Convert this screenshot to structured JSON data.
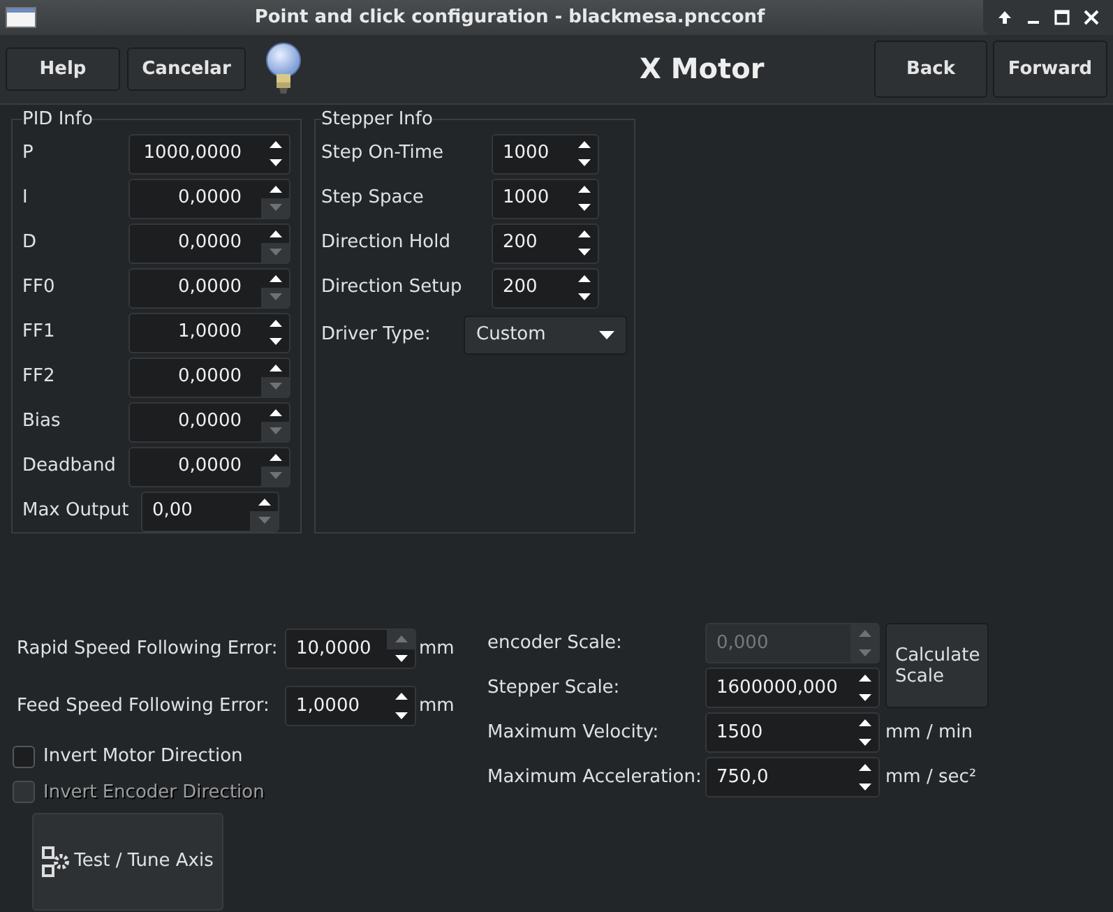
{
  "window": {
    "title": "Point and click configuration - blackmesa.pncconf"
  },
  "toolbar": {
    "left_buttons": [
      "Help",
      "Cancelar"
    ],
    "heading": "X Motor",
    "right_buttons": [
      "Back",
      "Forward"
    ]
  },
  "pid_info": {
    "title": "PID Info",
    "rows": [
      {
        "label": "P",
        "value": "1000,0000",
        "up_disabled": false,
        "down_disabled": false
      },
      {
        "label": "I",
        "value": "0,0000",
        "up_disabled": false,
        "down_disabled": true
      },
      {
        "label": "D",
        "value": "0,0000",
        "up_disabled": false,
        "down_disabled": true
      },
      {
        "label": "FF0",
        "value": "0,0000",
        "up_disabled": false,
        "down_disabled": true
      },
      {
        "label": "FF1",
        "value": "1,0000",
        "up_disabled": false,
        "down_disabled": false
      },
      {
        "label": "FF2",
        "value": "0,0000",
        "up_disabled": false,
        "down_disabled": true
      },
      {
        "label": "Bias",
        "value": "0,0000",
        "up_disabled": false,
        "down_disabled": true
      },
      {
        "label": "Deadband",
        "value": "0,0000",
        "up_disabled": false,
        "down_disabled": true
      },
      {
        "label": "Max Output",
        "value": "0,00",
        "up_disabled": false,
        "down_disabled": true
      }
    ]
  },
  "stepper_info": {
    "title": "Stepper Info",
    "rows": [
      {
        "kind": "spin",
        "label": "Step On-Time",
        "value": "1000",
        "up_disabled": false,
        "down_disabled": false
      },
      {
        "kind": "spin",
        "label": "Step Space",
        "value": "1000",
        "up_disabled": false,
        "down_disabled": false
      },
      {
        "kind": "spin",
        "label": "Direction Hold",
        "value": "200",
        "up_disabled": false,
        "down_disabled": false
      },
      {
        "kind": "spin",
        "label": "Direction Setup",
        "value": "200",
        "up_disabled": false,
        "down_disabled": false
      },
      {
        "kind": "dropdown",
        "label": "Driver Type:",
        "value": "Custom"
      }
    ]
  },
  "following_errors": [
    {
      "label": "Rapid Speed Following Error:",
      "value": "10,0000",
      "unit": "mm",
      "up_disabled": true,
      "down_disabled": false
    },
    {
      "label": "Feed Speed Following Error:",
      "value": "1,0000",
      "unit": "mm",
      "up_disabled": false,
      "down_disabled": false
    }
  ],
  "checkboxes": [
    {
      "label": "Invert Motor Direction",
      "checked": false,
      "disabled": false
    },
    {
      "label": "Invert Encoder Direction",
      "checked": false,
      "disabled": true
    }
  ],
  "test_button": "Test / Tune Axis",
  "scales": [
    {
      "label": "encoder Scale:",
      "value": "0,000",
      "disabled": true,
      "up_disabled": true,
      "down_disabled": true
    },
    {
      "label": "Stepper Scale:",
      "value": "1600000,000",
      "disabled": false,
      "up_disabled": false,
      "down_disabled": false
    },
    {
      "label": "Maximum Velocity:",
      "value": "1500",
      "unit": "mm / min",
      "disabled": false,
      "up_disabled": false,
      "down_disabled": false
    },
    {
      "label": "Maximum Acceleration:",
      "value": "750,0",
      "unit": "mm / sec²",
      "disabled": false,
      "up_disabled": false,
      "down_disabled": false
    }
  ],
  "calculate_button": "Calculate Scale"
}
